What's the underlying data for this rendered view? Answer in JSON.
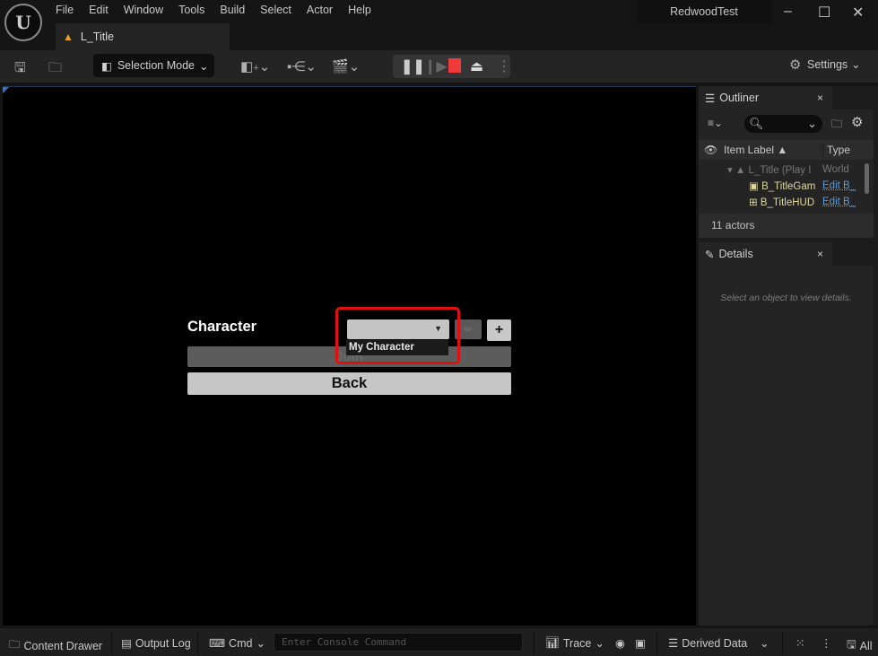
{
  "window": {
    "project_name": "RedwoodTest",
    "minimize_icon": "minimize-icon",
    "maximize_icon": "maximize-icon",
    "close_icon": "close-icon"
  },
  "menu": [
    "File",
    "Edit",
    "Window",
    "Tools",
    "Build",
    "Select",
    "Actor",
    "Help"
  ],
  "doc_tab": {
    "label": "L_Title",
    "icon": "level-icon"
  },
  "toolbar": {
    "selection_mode": "Selection Mode",
    "settings": "Settings",
    "icons": [
      "save-icon",
      "browse-icon",
      "add-actor-icon",
      "blueprint-icon",
      "cinematics-icon",
      "pause-icon",
      "step-icon",
      "stop-icon",
      "eject-icon",
      "more-icon"
    ],
    "stop_color": "#f03a3a"
  },
  "viewport": {
    "character_label": "Character",
    "dropdown_value": "",
    "dropdown_option": "My Character",
    "edit_icon": "pencil-icon",
    "add_label": "+",
    "join_label": "Join",
    "back_label": "Back",
    "highlight_color": "#e01010"
  },
  "outliner": {
    "tab_label": "Outliner",
    "close": "×",
    "columns": {
      "label": "Item Label ▲",
      "type": "Type"
    },
    "rows": [
      {
        "label": "L_Title (Play I",
        "type": "World",
        "level": 0
      },
      {
        "label": "B_TitleGam",
        "type": "Edit B_",
        "level": 1
      },
      {
        "label": "B_TitleHUD",
        "type": "Edit B_",
        "level": 1
      }
    ],
    "count": "11 actors"
  },
  "details": {
    "tab_label": "Details",
    "close": "×",
    "hint": "Select an object to view details."
  },
  "statusbar": {
    "content_drawer": "Content Drawer",
    "output_log": "Output Log",
    "cmd": "Cmd",
    "console_placeholder": "Enter Console Command",
    "trace": "Trace",
    "derived_data": "Derived Data",
    "all": "All"
  }
}
